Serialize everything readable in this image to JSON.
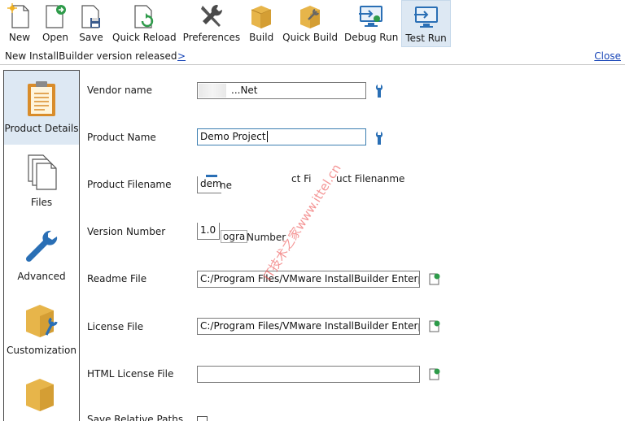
{
  "toolbar": {
    "new": "New",
    "open": "Open",
    "save": "Save",
    "quick_reload": "Quick Reload",
    "preferences": "Preferences",
    "build": "Build",
    "quick_build": "Quick Build",
    "debug_run": "Debug Run",
    "test_run": "Test Run"
  },
  "notice": {
    "message": "New InstallBuilder version released",
    "link": ">",
    "close": "Close"
  },
  "sidebar": {
    "items": [
      {
        "label": "Product Details",
        "icon": "clipboard-icon"
      },
      {
        "label": "Files",
        "icon": "files-icon"
      },
      {
        "label": "Advanced",
        "icon": "wrench-icon"
      },
      {
        "label": "Customization",
        "icon": "box-wrench-icon"
      },
      {
        "label": "",
        "icon": "box-icon"
      }
    ]
  },
  "form": {
    "vendor_name_label": "Vendor name",
    "vendor_name_value": "...Net",
    "product_name_label": "Product Name",
    "product_name_value": "Demo Project",
    "product_filename_label": "Product Filename",
    "product_filename_value": "demo",
    "product_filename_ghost_a": "ne",
    "product_filename_ghost_b": "ct Fi",
    "product_filename_ghost_c": "Fi",
    "product_filename_ghost_d": "uct Filenanme",
    "version_number_label": "Version Number",
    "version_number_value": "1.0",
    "version_ghost_a": "ogra",
    "version_ghost_b": "Number",
    "readme_file_label": "Readme File",
    "readme_file_value": "C:/Program Files/VMware InstallBuilder Enterpris",
    "license_file_label": "License File",
    "license_file_value": "C:/Program Files/VMware InstallBuilder Enterpris",
    "html_license_file_label": "HTML License File",
    "html_license_file_value": "",
    "save_relative_paths_label": "Save Relative Paths"
  },
  "watermark": "IT技术之家www.ittel.cn",
  "colors": {
    "accent_blue": "#2a6fb5",
    "active_bg": "#dde8f3",
    "link": "#1a47b8",
    "box_gold": "#e7b54a"
  }
}
